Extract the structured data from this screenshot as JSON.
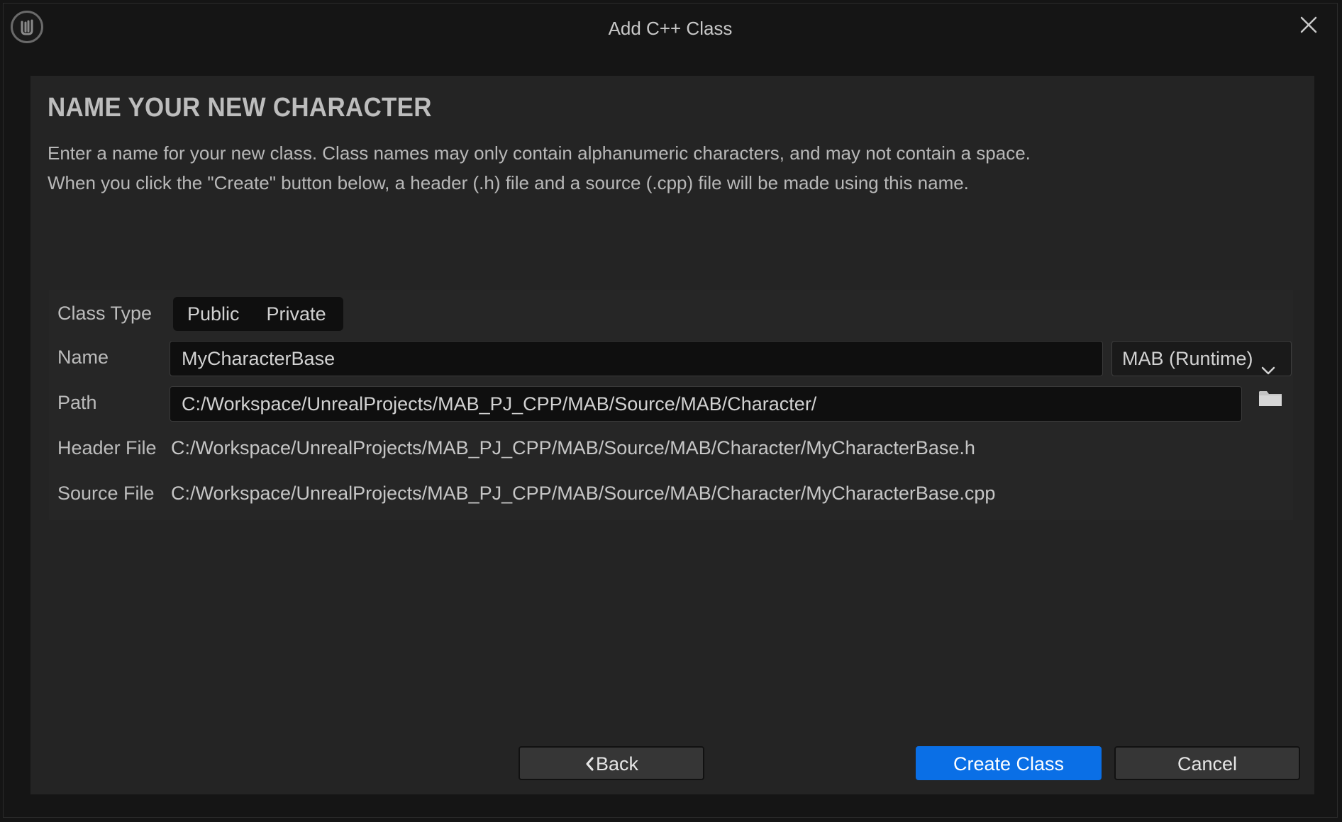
{
  "window": {
    "title": "Add C++ Class",
    "icons": {
      "logo": "unreal-logo-icon",
      "close": "close-icon"
    }
  },
  "page": {
    "heading": "NAME YOUR NEW CHARACTER",
    "description_line1": "Enter a name for your new class. Class names may only contain alphanumeric characters, and may not contain a space.",
    "description_line2": "When you click the \"Create\" button below, a header (.h) file and a source (.cpp) file will be made using this name."
  },
  "form": {
    "class_type_label": "Class Type",
    "class_type_options": [
      "Public",
      "Private"
    ],
    "name_label": "Name",
    "name_value": "MyCharacterBase",
    "module_value": "MAB (Runtime)",
    "path_label": "Path",
    "path_value": "C:/Workspace/UnrealProjects/MAB_PJ_CPP/MAB/Source/MAB/Character/",
    "header_file_label": "Header File",
    "header_file_value": "C:/Workspace/UnrealProjects/MAB_PJ_CPP/MAB/Source/MAB/Character/MyCharacterBase.h",
    "source_file_label": "Source File",
    "source_file_value": "C:/Workspace/UnrealProjects/MAB_PJ_CPP/MAB/Source/MAB/Character/MyCharacterBase.cpp"
  },
  "buttons": {
    "back": "Back",
    "create": "Create Class",
    "cancel": "Cancel"
  },
  "colors": {
    "background": "#151515",
    "panel": "#242424",
    "primary": "#0a6fe6"
  }
}
